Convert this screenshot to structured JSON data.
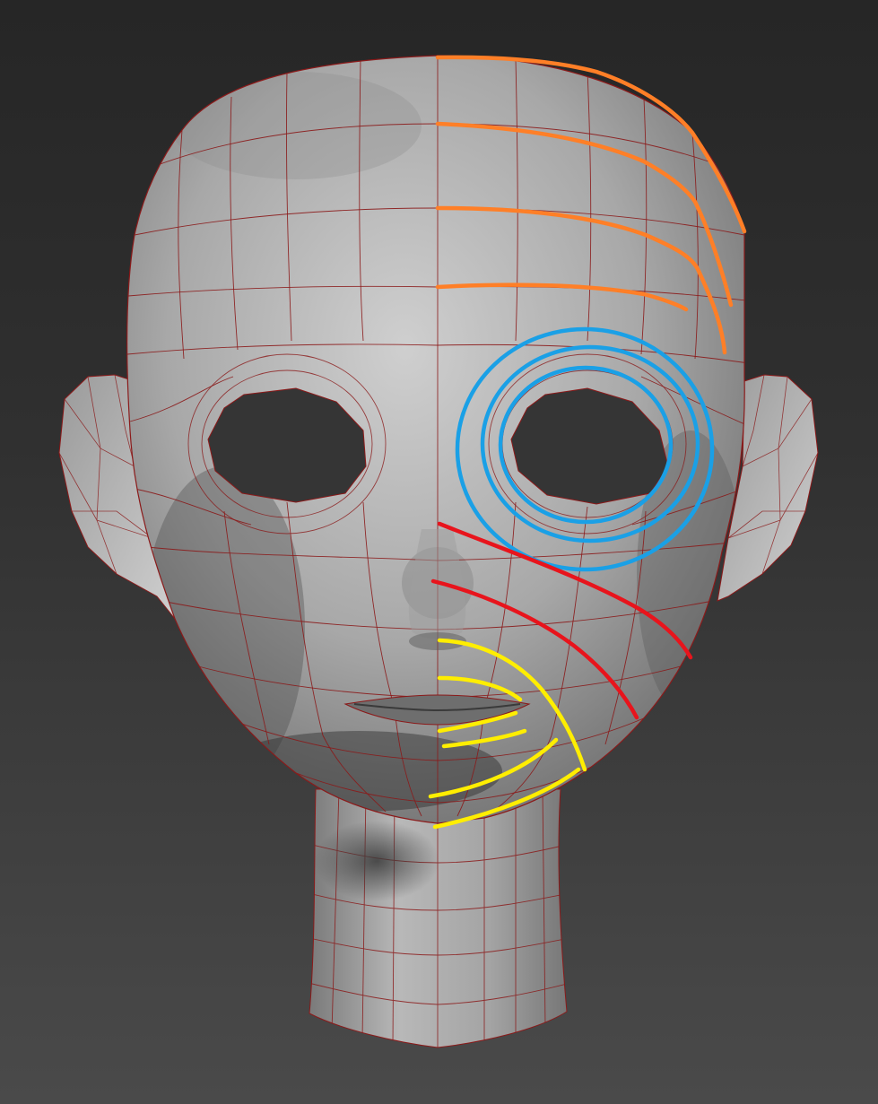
{
  "viewport": {
    "background_top": "#262626",
    "background_bottom": "#4a4a4a"
  },
  "model": {
    "subject": "head",
    "shading": "gray",
    "wire_color": "#8b1a1a",
    "skin_light": "#c4c4c4",
    "skin_dark": "#5a5a5a"
  },
  "edge_loops": {
    "forehead_color": "#ff7f27",
    "eye_color": "#1aa0e6",
    "cheek_color": "#e8141c",
    "mouth_color": "#ffee00"
  }
}
